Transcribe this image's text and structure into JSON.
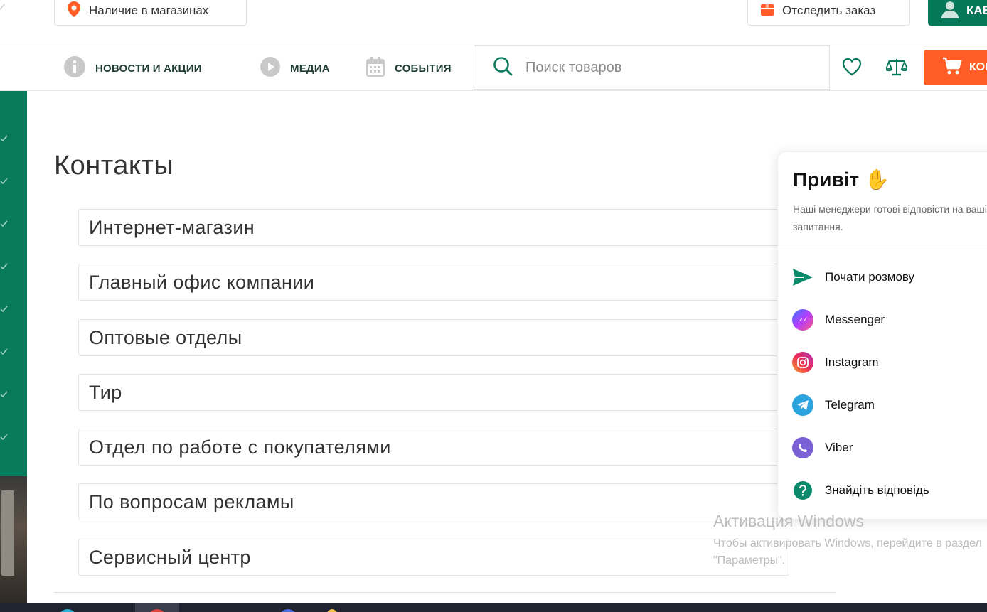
{
  "topbar": {
    "stores_label": "Наличие в магазинах",
    "track_label": "Отследить заказ",
    "cabinet_label": "КАБИНЕТ"
  },
  "nav": {
    "items": [
      {
        "label": "НОВОСТИ И АКЦИИ",
        "icon": "info-icon"
      },
      {
        "label": "МЕДИА",
        "icon": "play-icon"
      },
      {
        "label": "СОБЫТИЯ",
        "icon": "calendar-icon"
      }
    ],
    "search_placeholder": "Поиск товаров",
    "cart_label": "КОРЗИНА"
  },
  "main": {
    "title": "Контакты",
    "sections": [
      "Интернет-магазин",
      "Главный офис компании",
      "Оптовые отделы",
      "Тир",
      "Отдел по работе с покупателями",
      "По вопросам рекламы",
      "Сервисный центр"
    ]
  },
  "chat": {
    "title": "Привіт",
    "title_emoji": "✋",
    "subtitle": "Наші менеджери готові відповісти на ваші запитання.",
    "items": [
      {
        "label": "Почати розмову",
        "icon": "send-icon"
      },
      {
        "label": "Messenger",
        "icon": "messenger-icon"
      },
      {
        "label": "Instagram",
        "icon": "instagram-icon"
      },
      {
        "label": "Telegram",
        "icon": "telegram-icon"
      },
      {
        "label": "Viber",
        "icon": "viber-icon"
      },
      {
        "label": "Знайдіть відповідь",
        "icon": "help-icon"
      }
    ]
  },
  "watermark": {
    "title": "Активация Windows",
    "line1": "Чтобы активировать Windows, перейдите в раздел",
    "line2": "\"Параметры\"."
  },
  "colors": {
    "brand_green": "#06785a",
    "accent_orange": "#ff5c26"
  }
}
